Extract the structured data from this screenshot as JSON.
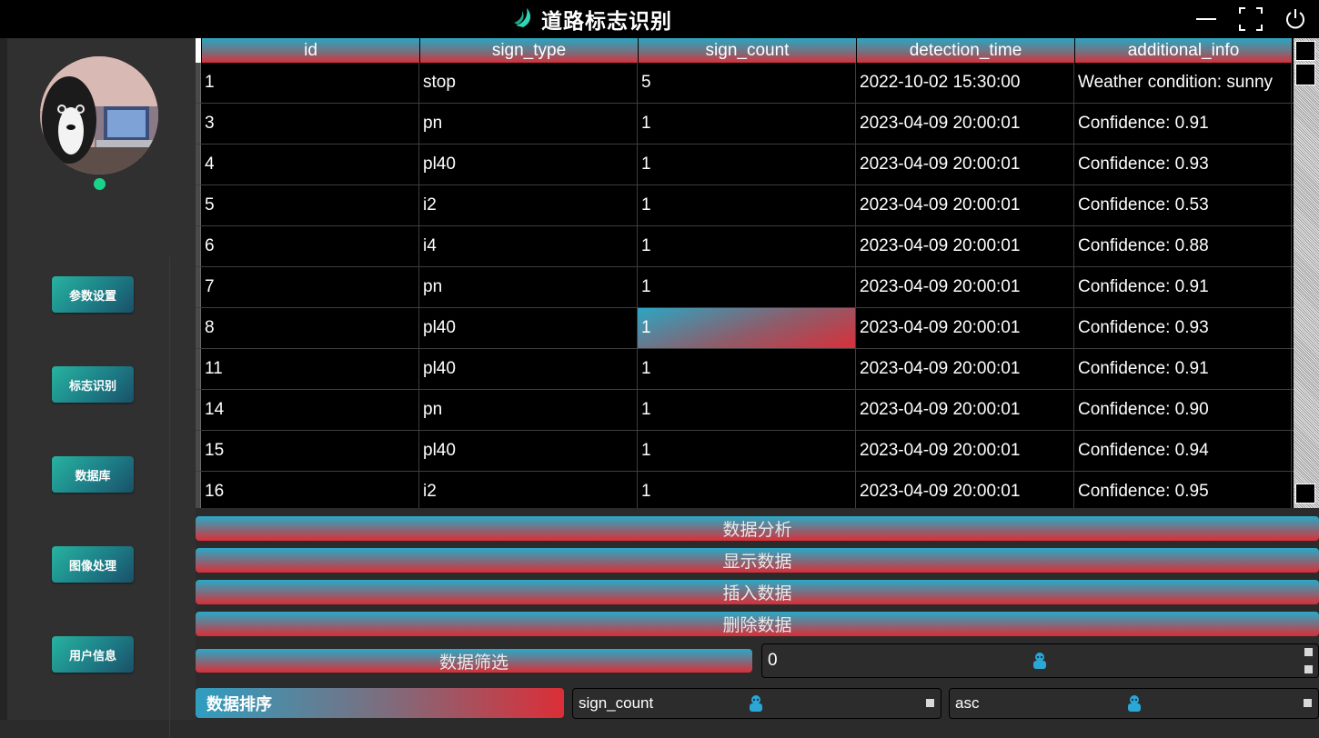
{
  "app": {
    "title": "道路标志识别"
  },
  "window_controls": [
    "minimize-icon",
    "maximize-icon",
    "power-icon"
  ],
  "sidebar": {
    "items": [
      {
        "label": "参数设置"
      },
      {
        "label": "标志识别"
      },
      {
        "label": "数据库"
      },
      {
        "label": "图像处理"
      },
      {
        "label": "用户信息"
      }
    ],
    "status_color": "#19d38a"
  },
  "table": {
    "columns": [
      "id",
      "sign_type",
      "sign_count",
      "detection_time",
      "additional_info"
    ],
    "rows": [
      [
        "1",
        "stop",
        "5",
        "2022-10-02 15:30:00",
        "Weather condition: sunny"
      ],
      [
        "3",
        "pn",
        "1",
        "2023-04-09 20:00:01",
        "Confidence: 0.91"
      ],
      [
        "4",
        "pl40",
        "1",
        "2023-04-09 20:00:01",
        "Confidence: 0.93"
      ],
      [
        "5",
        "i2",
        "1",
        "2023-04-09 20:00:01",
        "Confidence: 0.53"
      ],
      [
        "6",
        "i4",
        "1",
        "2023-04-09 20:00:01",
        "Confidence: 0.88"
      ],
      [
        "7",
        "pn",
        "1",
        "2023-04-09 20:00:01",
        "Confidence: 0.91"
      ],
      [
        "8",
        "pl40",
        "1",
        "2023-04-09 20:00:01",
        "Confidence: 0.93"
      ],
      [
        "11",
        "pl40",
        "1",
        "2023-04-09 20:00:01",
        "Confidence: 0.91"
      ],
      [
        "14",
        "pn",
        "1",
        "2023-04-09 20:00:01",
        "Confidence: 0.90"
      ],
      [
        "15",
        "pl40",
        "1",
        "2023-04-09 20:00:01",
        "Confidence: 0.94"
      ],
      [
        "16",
        "i2",
        "1",
        "2023-04-09 20:00:01",
        "Confidence: 0.95"
      ]
    ],
    "selected_row": 6,
    "selected_col": 2
  },
  "actions": {
    "analyze": "数据分析",
    "show": "显示数据",
    "insert": "插入数据",
    "delete": "删除数据",
    "filter": "数据筛选",
    "filter_value": "0"
  },
  "sort": {
    "label": "数据排序",
    "field": "sign_count",
    "order": "asc"
  },
  "colors": {
    "accent_cyan": "#2aa6c2",
    "accent_red": "#d8303a",
    "brand_teal": "#27b3a0"
  }
}
